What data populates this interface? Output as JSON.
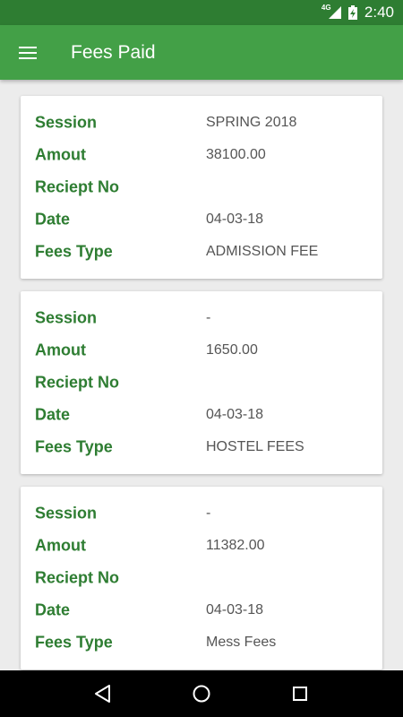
{
  "status_bar": {
    "network": "4G",
    "time": "2:40"
  },
  "app_bar": {
    "title": "Fees Paid",
    "menu_icon": "hamburger-menu-icon"
  },
  "colors": {
    "status_bar": "#2e7d32",
    "app_bar": "#43a047",
    "label_green": "#2e7d32",
    "background": "#ececec"
  },
  "fee_records": [
    {
      "session_label": "Session",
      "session": "SPRING 2018",
      "amount_label": "Amout",
      "amount": "38100.00",
      "receipt_label": "Reciept No",
      "receipt": "",
      "date_label": "Date",
      "date": "04-03-18",
      "type_label": "Fees Type",
      "type": "ADMISSION FEE"
    },
    {
      "session_label": "Session",
      "session": "-",
      "amount_label": "Amout",
      "amount": "1650.00",
      "receipt_label": "Reciept No",
      "receipt": "",
      "date_label": "Date",
      "date": "04-03-18",
      "type_label": "Fees Type",
      "type": "HOSTEL FEES"
    },
    {
      "session_label": "Session",
      "session": "-",
      "amount_label": "Amout",
      "amount": "11382.00",
      "receipt_label": "Reciept No",
      "receipt": "",
      "date_label": "Date",
      "date": "04-03-18",
      "type_label": "Fees Type",
      "type": "Mess Fees"
    }
  ],
  "nav_bar": {
    "back_icon": "back-triangle-icon",
    "home_icon": "home-circle-icon",
    "recents_icon": "recents-square-icon"
  }
}
